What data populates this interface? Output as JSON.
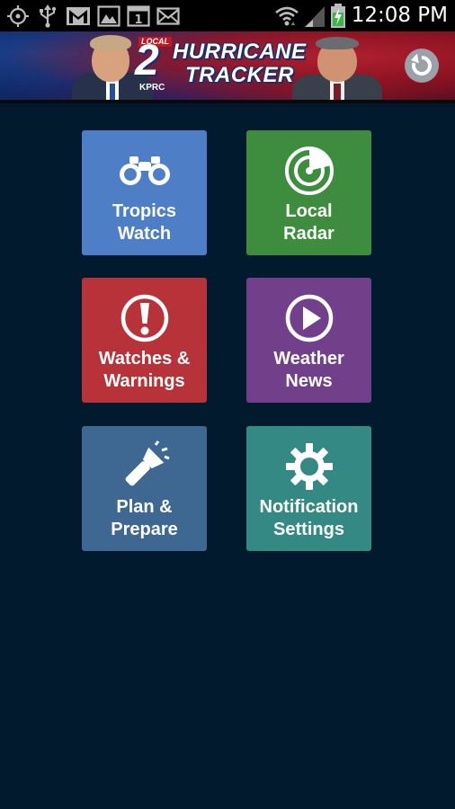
{
  "status_bar": {
    "time": "12:08 PM",
    "icons": [
      "gps-icon",
      "usb-icon",
      "gmail-icon",
      "gallery-icon",
      "calendar-icon",
      "email-icon",
      "wifi-icon",
      "signal-icon",
      "battery-charging-icon"
    ],
    "calendar_day": "1"
  },
  "banner": {
    "logo_local": "LOCAL",
    "logo_number": "2",
    "logo_station": "KPRC",
    "title_line1": "HURRICANE",
    "title_line2": "TRACKER",
    "refresh_icon": "refresh-icon"
  },
  "tiles": [
    {
      "line1": "Tropics",
      "line2": "Watch",
      "icon": "binoculars-icon",
      "color": "#4e7fc6"
    },
    {
      "line1": "Local",
      "line2": "Radar",
      "icon": "radar-icon",
      "color": "#3e8d3e"
    },
    {
      "line1": "Watches &",
      "line2": "Warnings",
      "icon": "alert-icon",
      "color": "#b73339"
    },
    {
      "line1": "Weather",
      "line2": "News",
      "icon": "play-icon",
      "color": "#72408a"
    },
    {
      "line1": "Plan &",
      "line2": "Prepare",
      "icon": "flashlight-icon",
      "color": "#3e6791"
    },
    {
      "line1": "Notification",
      "line2": "Settings",
      "icon": "gear-icon",
      "color": "#358985"
    }
  ],
  "colors": {
    "background": "#021a2e",
    "status_bar": "#000000",
    "refresh_button": "#9aa1a8"
  }
}
